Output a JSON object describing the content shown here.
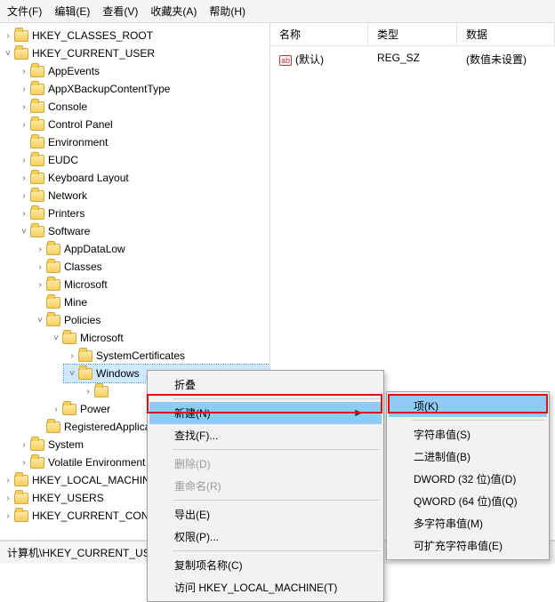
{
  "menubar": [
    "文件(F)",
    "编辑(E)",
    "查看(V)",
    "收藏夹(A)",
    "帮助(H)"
  ],
  "tree": {
    "roots": [
      {
        "label": "HKEY_CLASSES_ROOT",
        "expander": ">"
      },
      {
        "label": "HKEY_CURRENT_USER",
        "expander": "v",
        "children": [
          {
            "label": "AppEvents",
            "expander": ">"
          },
          {
            "label": "AppXBackupContentType",
            "expander": ">"
          },
          {
            "label": "Console",
            "expander": ">"
          },
          {
            "label": "Control Panel",
            "expander": ">"
          },
          {
            "label": "Environment",
            "expander": ""
          },
          {
            "label": "EUDC",
            "expander": ">"
          },
          {
            "label": "Keyboard Layout",
            "expander": ">"
          },
          {
            "label": "Network",
            "expander": ">"
          },
          {
            "label": "Printers",
            "expander": ">"
          },
          {
            "label": "Software",
            "expander": "v",
            "children": [
              {
                "label": "AppDataLow",
                "expander": ">"
              },
              {
                "label": "Classes",
                "expander": ">"
              },
              {
                "label": "Microsoft",
                "expander": ">"
              },
              {
                "label": "Mine",
                "expander": ""
              },
              {
                "label": "Policies",
                "expander": "v",
                "children": [
                  {
                    "label": "Microsoft",
                    "expander": "v",
                    "children": [
                      {
                        "label": "SystemCertificates",
                        "expander": ">"
                      },
                      {
                        "label": "Windows",
                        "expander": "v",
                        "sel": true,
                        "children": [
                          {
                            "label": "",
                            "expander": ">"
                          }
                        ]
                      }
                    ]
                  },
                  {
                    "label": "Power",
                    "expander": ">"
                  }
                ]
              },
              {
                "label": "RegisteredApplications",
                "expander": ""
              }
            ]
          },
          {
            "label": "System",
            "expander": ">"
          },
          {
            "label": "Volatile Environment",
            "expander": ">"
          }
        ]
      },
      {
        "label": "HKEY_LOCAL_MACHINE",
        "expander": ">"
      },
      {
        "label": "HKEY_USERS",
        "expander": ">"
      },
      {
        "label": "HKEY_CURRENT_CONFIG",
        "expander": ">"
      }
    ]
  },
  "list": {
    "headers": [
      "名称",
      "类型",
      "数据"
    ],
    "rows": [
      {
        "name": "(默认)",
        "type": "REG_SZ",
        "data": "(数值未设置)"
      }
    ]
  },
  "statusbar": "计算机\\HKEY_CURRENT_USER\\Software\\Policies\\Microsoft\\Windows",
  "ctx1": [
    {
      "label": "折叠",
      "kind": "item"
    },
    {
      "kind": "sep"
    },
    {
      "label": "新建(N)",
      "kind": "item",
      "hover": true,
      "sub": true
    },
    {
      "label": "查找(F)...",
      "kind": "item"
    },
    {
      "kind": "sep"
    },
    {
      "label": "删除(D)",
      "kind": "item",
      "disabled": true
    },
    {
      "label": "重命名(R)",
      "kind": "item",
      "disabled": true
    },
    {
      "kind": "sep"
    },
    {
      "label": "导出(E)",
      "kind": "item"
    },
    {
      "label": "权限(P)...",
      "kind": "item"
    },
    {
      "kind": "sep"
    },
    {
      "label": "复制项名称(C)",
      "kind": "item"
    },
    {
      "label": "访问 HKEY_LOCAL_MACHINE(T)",
      "kind": "item"
    }
  ],
  "ctx2": [
    {
      "label": "项(K)",
      "hover": true
    },
    {
      "kind": "sep"
    },
    {
      "label": "字符串值(S)"
    },
    {
      "label": "二进制值(B)"
    },
    {
      "label": "DWORD (32 位)值(D)"
    },
    {
      "label": "QWORD (64 位)值(Q)"
    },
    {
      "label": "多字符串值(M)"
    },
    {
      "label": "可扩充字符串值(E)"
    }
  ]
}
